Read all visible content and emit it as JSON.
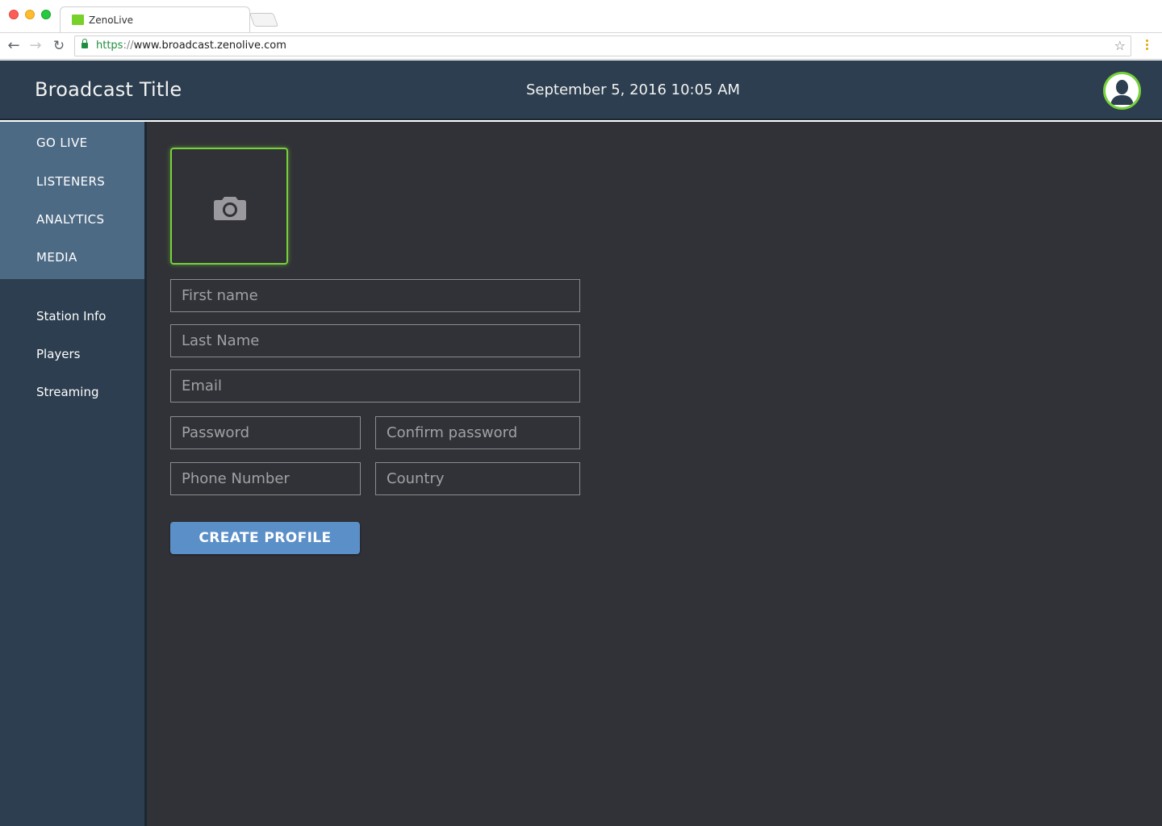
{
  "browser": {
    "tab_title": "ZenoLive",
    "url_scheme": "https",
    "url_separator": "://",
    "url_host": "www.broadcast.zenolive.com",
    "favicon_color": "#78d02a"
  },
  "header": {
    "title": "Broadcast Title",
    "datetime": "September 5, 2016 10:05 AM",
    "background_color": "#2c3e4f"
  },
  "sidebar": {
    "primary_items": [
      {
        "label": "GO LIVE"
      },
      {
        "label": "LISTENERS"
      },
      {
        "label": "ANALYTICS"
      },
      {
        "label": "MEDIA"
      }
    ],
    "secondary_items": [
      {
        "label": "Station Info"
      },
      {
        "label": "Players"
      },
      {
        "label": "Streaming"
      }
    ],
    "primary_bg_color": "#4d6a85"
  },
  "form": {
    "photo_icon": "camera-icon",
    "first_name_placeholder": "First name",
    "last_name_placeholder": "Last Name",
    "email_placeholder": "Email",
    "password_placeholder": "Password",
    "confirm_password_placeholder": "Confirm password",
    "phone_placeholder": "Phone Number",
    "country_placeholder": "Country",
    "submit_label": "CREATE PROFILE",
    "accent_color": "#76d13a",
    "button_color": "#5b8fc8"
  }
}
